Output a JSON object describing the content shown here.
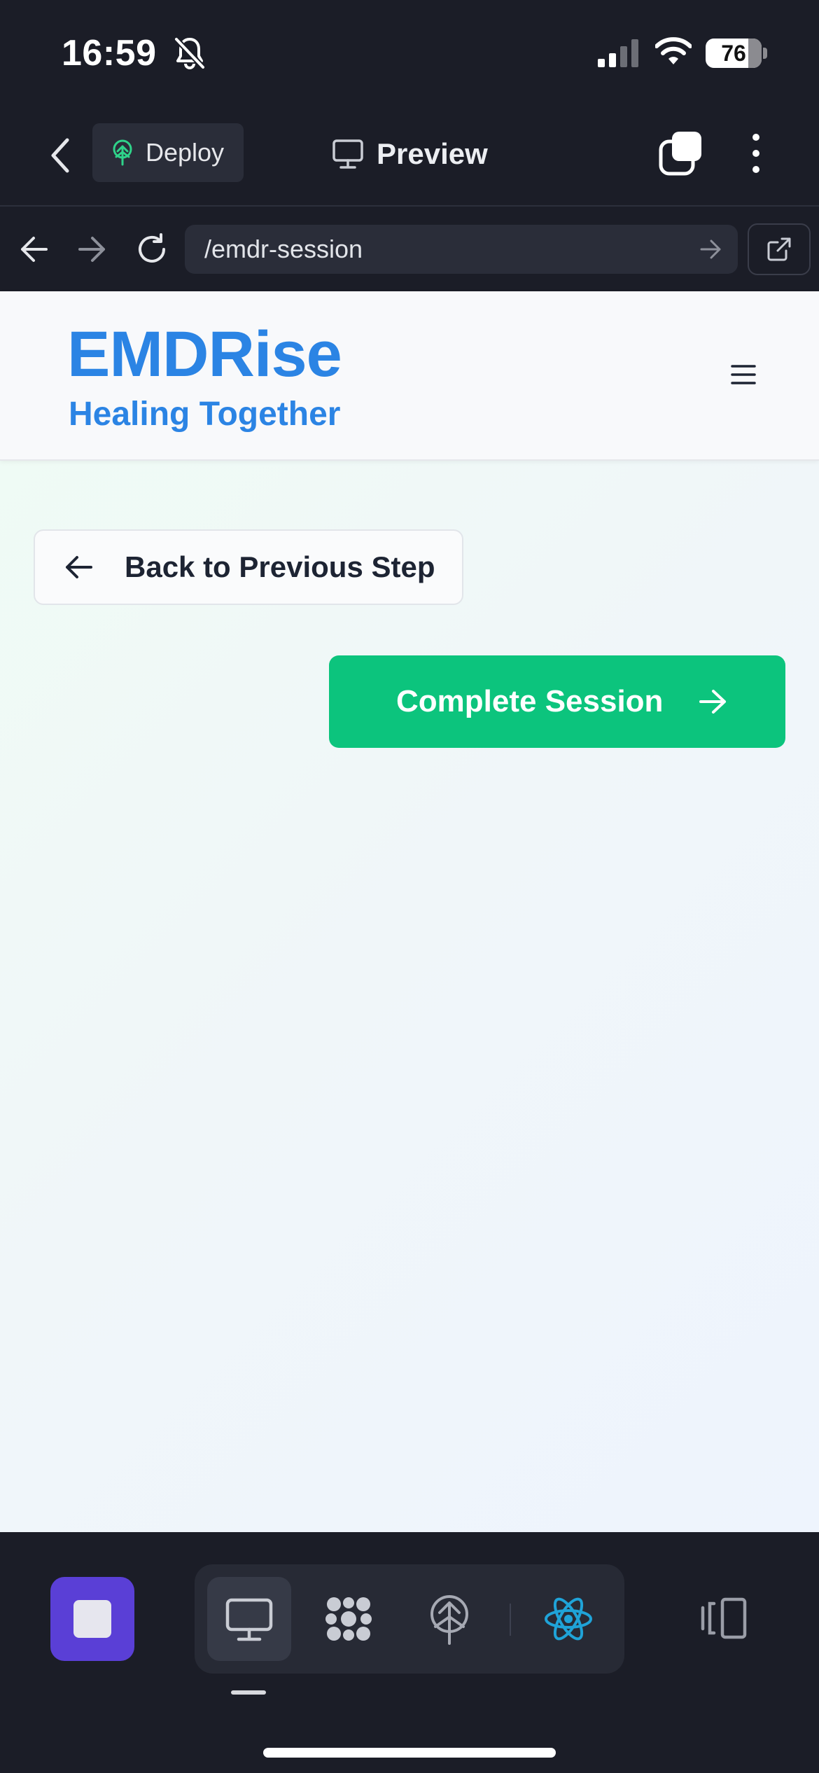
{
  "status_bar": {
    "time": "16:59",
    "battery_level": "76",
    "icons": [
      "bell-off-icon",
      "cellular-signal-icon",
      "wifi-icon",
      "battery-icon"
    ]
  },
  "app_toolbar": {
    "deploy_label": "Deploy",
    "preview_label": "Preview",
    "icons": [
      "chevron-left-icon",
      "deploy-tree-icon",
      "monitor-icon",
      "windows-icon",
      "more-vertical-icon"
    ]
  },
  "browser": {
    "url": "/emdr-session",
    "icons": [
      "arrow-left-icon",
      "arrow-right-icon",
      "reload-icon",
      "url-go-icon",
      "external-link-icon"
    ]
  },
  "site": {
    "brand": "EMDRise",
    "tagline": "Healing Together",
    "menu_icon": "hamburger-menu-icon"
  },
  "main": {
    "back_button_label": "Back to Previous Step",
    "complete_button_label": "Complete Session"
  },
  "dock": {
    "tools": [
      "monitor-icon",
      "nodes-icon",
      "deploy-tree-icon",
      "react-icon"
    ],
    "layout_icon": "layout-toggle-icon"
  },
  "colors": {
    "brand_blue": "#2b84e4",
    "complete_green": "#0cc47d",
    "stop_purple": "#5a3fd6",
    "dark_bg": "#1b1d27"
  }
}
